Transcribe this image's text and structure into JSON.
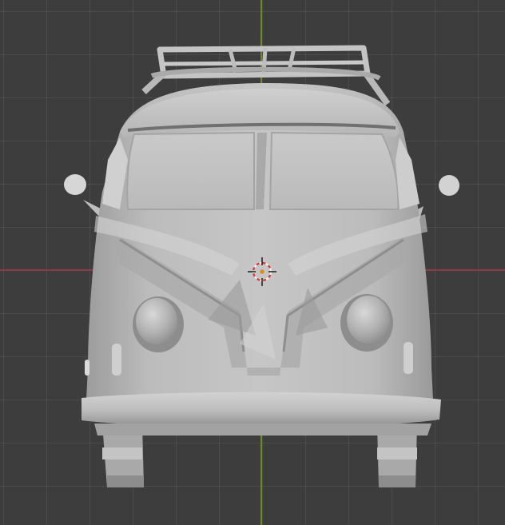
{
  "viewport": {
    "grid": true,
    "background_color": "#3d3d3d",
    "x_axis_color": "#8e3a44",
    "y_axis_color": "#6f8a23"
  },
  "model": {
    "body_color": "#bdbdbd",
    "shade_color": "#9a9a9a",
    "highlight_color": "#dadada",
    "shading": "solid"
  },
  "cursor": {
    "icon": "3d-cursor-icon",
    "ring_color_a": "#d43a3a",
    "ring_color_b": "#f0f0f0"
  }
}
